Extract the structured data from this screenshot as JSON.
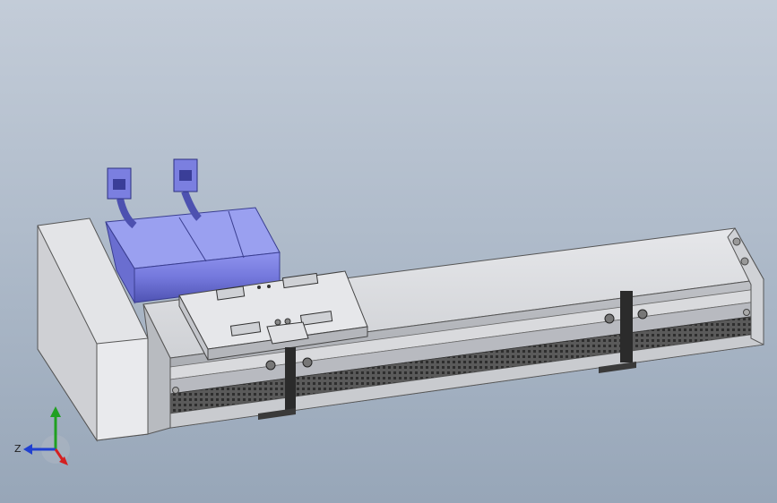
{
  "view": {
    "background_top": "#c3ccd8",
    "background_bottom": "#97a6b8",
    "model_colors": {
      "housing": "#d8d9dc",
      "housing_shadow": "#a9abb0",
      "motor": "#7c80e0",
      "motor_dark": "#5458b8",
      "rail": "#c7c9cd",
      "belt": "#4a4a4a",
      "bracket": "#2b2b2b"
    }
  },
  "triad": {
    "x_color": "#d42020",
    "y_color": "#20a020",
    "z_color": "#2040d0",
    "z_label": "Z"
  }
}
